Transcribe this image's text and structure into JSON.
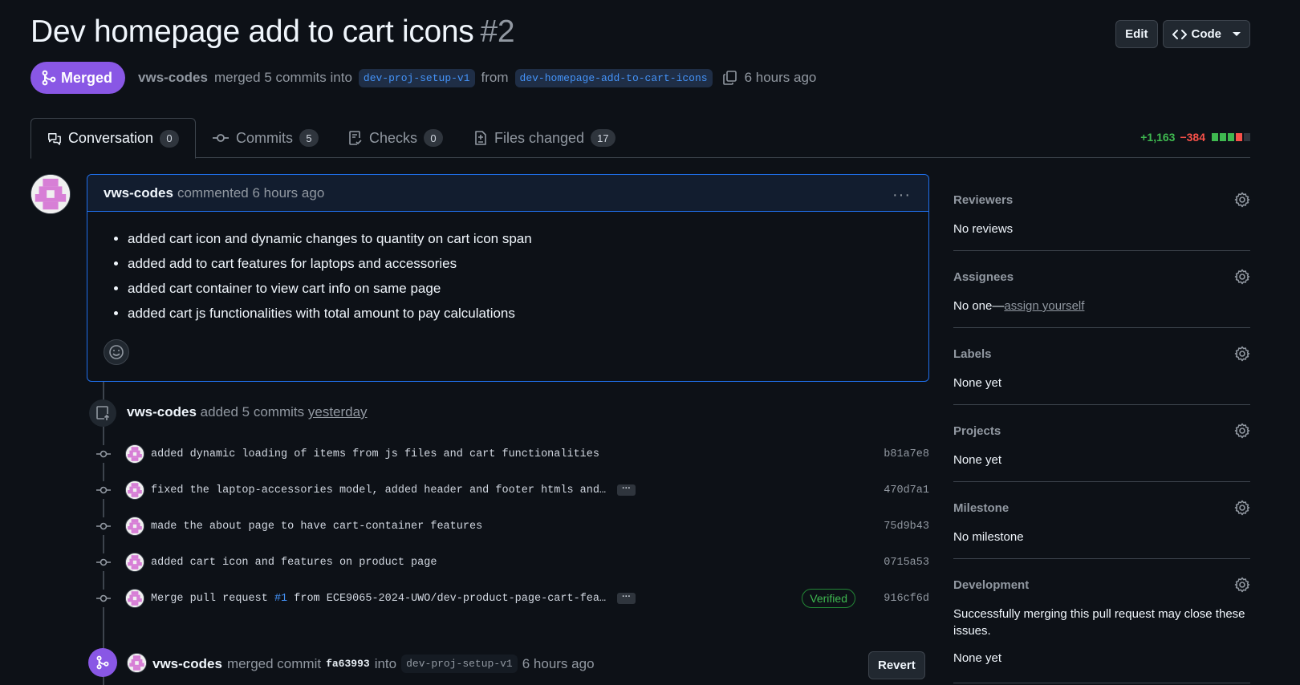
{
  "pr": {
    "title": "Dev homepage add to cart icons",
    "number": "#2",
    "state": "Merged",
    "author": "vws-codes",
    "merged_text": "merged 5 commits into",
    "base_branch": "dev-proj-setup-v1",
    "from_text": "from",
    "head_branch": "dev-homepage-add-to-cart-icons",
    "time": "6 hours ago"
  },
  "header_buttons": {
    "edit": "Edit",
    "code": "Code"
  },
  "tabs": [
    {
      "label": "Conversation",
      "count": "0"
    },
    {
      "label": "Commits",
      "count": "5"
    },
    {
      "label": "Checks",
      "count": "0"
    },
    {
      "label": "Files changed",
      "count": "17"
    }
  ],
  "diffstat": {
    "additions": "+1,163",
    "deletions": "−384"
  },
  "comment": {
    "author": "vws-codes",
    "action": "commented 6 hours ago",
    "bullets": [
      "added cart icon and dynamic changes to quantity on cart icon span",
      "added add to cart features for laptops and accessories",
      "added cart container to view cart info on same page",
      "added cart js functionalities with total amount to pay calculations"
    ]
  },
  "commits_event": {
    "author": "vws-codes",
    "text": "added 5 commits",
    "when": "yesterday"
  },
  "commits": [
    {
      "message": "added dynamic loading of items from js files and cart functionalities",
      "sha": "b81a7e8"
    },
    {
      "message": "fixed the laptop-accessories model, added header and footer htmls and…",
      "sha": "470d7a1"
    },
    {
      "message": "made the about page to have cart-container features",
      "sha": "75d9b43"
    },
    {
      "message": "added cart icon and features on product page",
      "sha": "0715a53"
    },
    {
      "message_prefix": "Merge pull request ",
      "message_link": "#1",
      "message_suffix": " from ECE9065-2024-UWO/dev-product-page-cart-fea…",
      "sha": "916cf6d",
      "badge": "Verified"
    }
  ],
  "ellipsis": "···",
  "merge_event": {
    "author": "vws-codes",
    "text": "merged commit",
    "commit": "fa63993",
    "into": "into",
    "branch": "dev-proj-setup-v1",
    "time": "6 hours ago",
    "revert": "Revert"
  },
  "sidebar": {
    "reviewers": {
      "title": "Reviewers",
      "value": "No reviews"
    },
    "assignees": {
      "title": "Assignees",
      "value": "No one—",
      "link": "assign yourself"
    },
    "labels": {
      "title": "Labels",
      "value": "None yet"
    },
    "projects": {
      "title": "Projects",
      "value": "None yet"
    },
    "milestone": {
      "title": "Milestone",
      "value": "No milestone"
    },
    "development": {
      "title": "Development",
      "note": "Successfully merging this pull request may close these issues.",
      "value": "None yet"
    }
  },
  "colors": {
    "accent_merged": "#8957e5",
    "link": "#4493f8",
    "add": "#3fb950",
    "del": "#f85149"
  }
}
